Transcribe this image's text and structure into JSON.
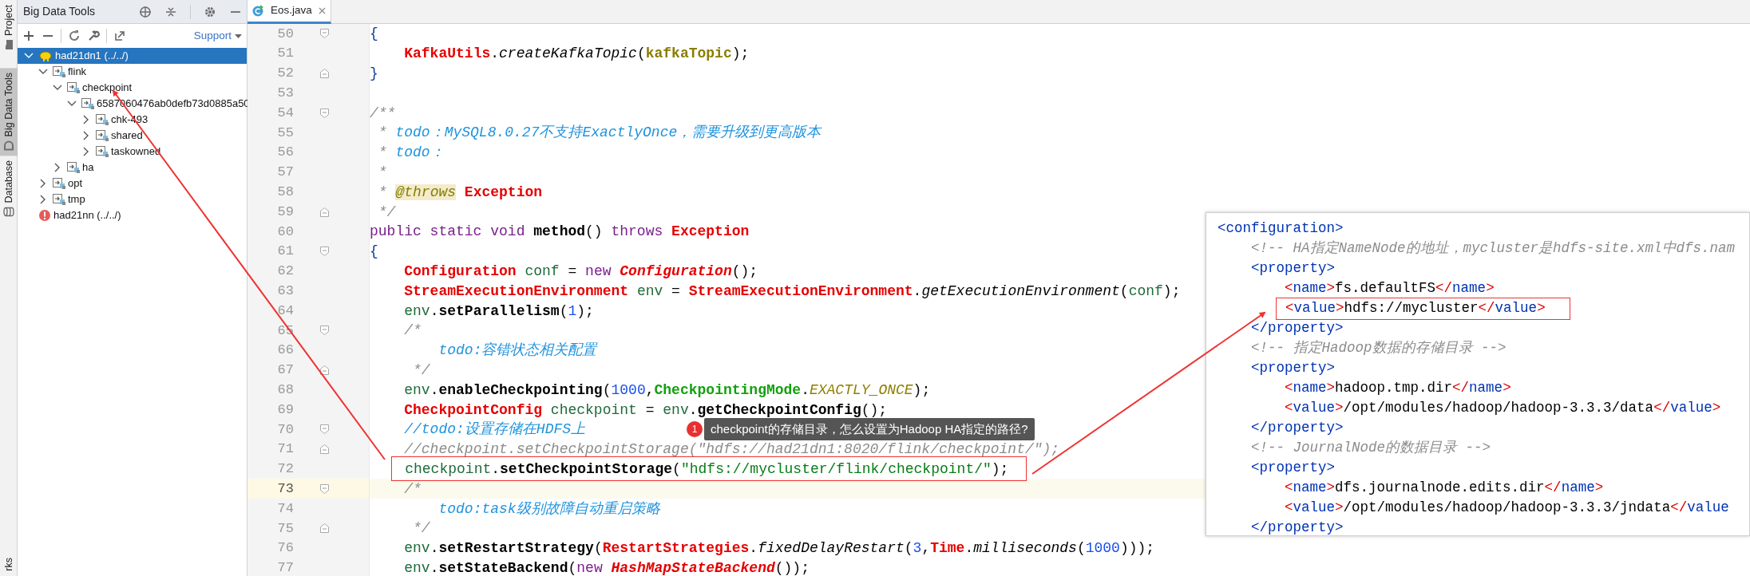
{
  "side_tabs": [
    {
      "label": "Project",
      "selected": false
    },
    {
      "label": "Big Data Tools",
      "selected": true
    },
    {
      "label": "Database",
      "selected": false
    },
    {
      "label": "rks",
      "selected": false
    }
  ],
  "panel": {
    "title": "Big Data Tools",
    "support": "Support"
  },
  "tree": [
    {
      "label": "had21dn1 (../../)",
      "kind": "cluster",
      "selected": true,
      "expanded": true,
      "children": [
        {
          "label": "flink",
          "kind": "folder",
          "selected": false,
          "expanded": true,
          "children": [
            {
              "label": "checkpoint",
              "kind": "folder",
              "selected": false,
              "expanded": true,
              "children": [
                {
                  "label": "6587060476ab0defb73d0885a50",
                  "kind": "folder",
                  "selected": false,
                  "expanded": true,
                  "children": [
                    {
                      "label": "chk-493",
                      "kind": "folder",
                      "selected": false,
                      "expanded": false
                    },
                    {
                      "label": "shared",
                      "kind": "folder",
                      "selected": false,
                      "expanded": false
                    },
                    {
                      "label": "taskowned",
                      "kind": "folder",
                      "selected": false,
                      "expanded": false
                    }
                  ]
                }
              ]
            },
            {
              "label": "ha",
              "kind": "folder",
              "selected": false,
              "expanded": false
            }
          ]
        },
        {
          "label": "opt",
          "kind": "folder",
          "selected": false,
          "expanded": false
        },
        {
          "label": "tmp",
          "kind": "folder",
          "selected": false,
          "expanded": false
        }
      ]
    },
    {
      "label": "had21nn (../../)",
      "kind": "failed",
      "selected": false
    }
  ],
  "editor": {
    "tabs": [
      {
        "label": "Eos.java",
        "selected": true
      }
    ],
    "lines": [
      {
        "number": "50",
        "current": false,
        "fold_start": true,
        "segments": [
          {
            "text": "{",
            "kind": "brace"
          }
        ]
      },
      {
        "number": "51",
        "current": false,
        "segments": [
          {
            "text": "    KafkaUtils",
            "kind": "cls"
          },
          {
            "text": ".",
            "kind": "plain"
          },
          {
            "text": "createKafkaTopic",
            "kind": "call"
          },
          {
            "text": "(",
            "kind": "plain"
          },
          {
            "text": "kafkaTopic",
            "kind": "param"
          },
          {
            "text": ");",
            "kind": "plain"
          }
        ]
      },
      {
        "number": "52",
        "current": false,
        "fold_end": true,
        "segments": [
          {
            "text": "}",
            "kind": "brace"
          }
        ]
      },
      {
        "number": "53",
        "current": false
      },
      {
        "number": "54",
        "current": false,
        "fold_start": true,
        "segments": [
          {
            "text": "/**",
            "kind": "cmt"
          }
        ]
      },
      {
        "number": "55",
        "current": false,
        "segments": [
          {
            "text": " * ",
            "kind": "cmt"
          },
          {
            "text": "todo：MySQL8.0.27不支持ExactlyOnce，需要升级到更高版本",
            "kind": "todo"
          }
        ]
      },
      {
        "number": "56",
        "current": false,
        "segments": [
          {
            "text": " * ",
            "kind": "cmt"
          },
          {
            "text": "todo：",
            "kind": "todo"
          }
        ]
      },
      {
        "number": "57",
        "current": false,
        "segments": [
          {
            "text": " *",
            "kind": "cmt"
          }
        ]
      },
      {
        "number": "58",
        "current": false,
        "segments": [
          {
            "text": " * ",
            "kind": "cmt"
          },
          {
            "text": "@throws",
            "kind": "ann"
          },
          {
            "text": " Exception",
            "kind": "cls"
          }
        ]
      },
      {
        "number": "59",
        "current": false,
        "fold_end": true,
        "segments": [
          {
            "text": " */",
            "kind": "cmt"
          }
        ]
      },
      {
        "number": "60",
        "current": false,
        "segments": [
          {
            "text": "public static void ",
            "kind": "kw"
          },
          {
            "text": "method",
            "kind": "method"
          },
          {
            "text": "()",
            "kind": "plain"
          },
          {
            "text": " throws ",
            "kind": "kw"
          },
          {
            "text": "Exception",
            "kind": "cls"
          }
        ]
      },
      {
        "number": "61",
        "current": false,
        "fold_start": true,
        "segments": [
          {
            "text": "{",
            "kind": "brace"
          }
        ]
      },
      {
        "number": "62",
        "current": false,
        "segments": [
          {
            "text": "    Configuration",
            "kind": "cls"
          },
          {
            "text": " conf",
            "kind": "local"
          },
          {
            "text": " = ",
            "kind": "plain"
          },
          {
            "text": "new ",
            "kind": "kw"
          },
          {
            "text": "Configuration",
            "kind": "clsi"
          },
          {
            "text": "();",
            "kind": "plain"
          }
        ]
      },
      {
        "number": "63",
        "current": false,
        "segments": [
          {
            "text": "    StreamExecutionEnvironment",
            "kind": "cls"
          },
          {
            "text": " env",
            "kind": "local"
          },
          {
            "text": " = ",
            "kind": "plain"
          },
          {
            "text": "StreamExecutionEnvironment",
            "kind": "cls"
          },
          {
            "text": ".",
            "kind": "plain"
          },
          {
            "text": "getExecutionEnvironment",
            "kind": "call"
          },
          {
            "text": "(",
            "kind": "plain"
          },
          {
            "text": "conf",
            "kind": "local"
          },
          {
            "text": ");",
            "kind": "plain"
          }
        ]
      },
      {
        "number": "64",
        "current": false,
        "segments": [
          {
            "text": "    env",
            "kind": "local"
          },
          {
            "text": ".",
            "kind": "plain"
          },
          {
            "text": "setParallelism",
            "kind": "method"
          },
          {
            "text": "(",
            "kind": "plain"
          },
          {
            "text": "1",
            "kind": "num"
          },
          {
            "text": ");",
            "kind": "plain"
          }
        ]
      },
      {
        "number": "65",
        "current": false,
        "fold_start": true,
        "segments": [
          {
            "text": "    /*",
            "kind": "cmt"
          }
        ]
      },
      {
        "number": "66",
        "current": false,
        "segments": [
          {
            "text": "        todo:容错状态相关配置",
            "kind": "todo"
          }
        ]
      },
      {
        "number": "67",
        "current": false,
        "fold_end": true,
        "segments": [
          {
            "text": "     */",
            "kind": "cmt"
          }
        ]
      },
      {
        "number": "68",
        "current": false,
        "segments": [
          {
            "text": "    env",
            "kind": "local"
          },
          {
            "text": ".",
            "kind": "plain"
          },
          {
            "text": "enableCheckpointing",
            "kind": "method"
          },
          {
            "text": "(",
            "kind": "plain"
          },
          {
            "text": "1000",
            "kind": "num"
          },
          {
            "text": ",",
            "kind": "plain"
          },
          {
            "text": "CheckpointingMode",
            "kind": "enum"
          },
          {
            "text": ".",
            "kind": "plain"
          },
          {
            "text": "EXACTLY_ONCE",
            "kind": "const"
          },
          {
            "text": ");",
            "kind": "plain"
          }
        ]
      },
      {
        "number": "69",
        "current": false,
        "segments": [
          {
            "text": "    CheckpointConfig",
            "kind": "cls"
          },
          {
            "text": " checkpoint",
            "kind": "local"
          },
          {
            "text": " = ",
            "kind": "plain"
          },
          {
            "text": "env",
            "kind": "local"
          },
          {
            "text": ".",
            "kind": "plain"
          },
          {
            "text": "getCheckpointConfig",
            "kind": "method"
          },
          {
            "text": "();",
            "kind": "plain"
          }
        ]
      },
      {
        "number": "70",
        "current": false,
        "fold_start": true,
        "segments": [
          {
            "text": "    //todo:设置存储在HDFS上",
            "kind": "todo"
          }
        ]
      },
      {
        "number": "71",
        "current": false,
        "fold_end": true,
        "segments": [
          {
            "text": "    //checkpoint.setCheckpointStorage(\"hdfs://had21dn1:8020/flink/checkpoint/\");",
            "kind": "cmt"
          }
        ]
      },
      {
        "number": "72",
        "current": false,
        "framed": true,
        "segments": [
          {
            "text": "    checkpoint",
            "kind": "local"
          },
          {
            "text": ".",
            "kind": "plain"
          },
          {
            "text": "setCheckpointStorage",
            "kind": "method"
          },
          {
            "text": "(",
            "kind": "plain"
          },
          {
            "text": "\"hdfs://mycluster/flink/checkpoint/\"",
            "kind": "str"
          },
          {
            "text": ");",
            "kind": "plain"
          }
        ]
      },
      {
        "number": "73",
        "current": true,
        "fold_start": true,
        "segments": [
          {
            "text": "    /*",
            "kind": "cmt"
          }
        ]
      },
      {
        "number": "74",
        "current": false,
        "segments": [
          {
            "text": "        todo:task级别故障自动重启策略",
            "kind": "todo"
          }
        ]
      },
      {
        "number": "75",
        "current": false,
        "fold_end": true,
        "segments": [
          {
            "text": "     */",
            "kind": "cmt"
          }
        ]
      },
      {
        "number": "76",
        "current": false,
        "segments": [
          {
            "text": "    env",
            "kind": "local"
          },
          {
            "text": ".",
            "kind": "plain"
          },
          {
            "text": "setRestartStrategy",
            "kind": "method"
          },
          {
            "text": "(",
            "kind": "plain"
          },
          {
            "text": "RestartStrategies",
            "kind": "cls"
          },
          {
            "text": ".",
            "kind": "plain"
          },
          {
            "text": "fixedDelayRestart",
            "kind": "call"
          },
          {
            "text": "(",
            "kind": "plain"
          },
          {
            "text": "3",
            "kind": "num"
          },
          {
            "text": ",",
            "kind": "plain"
          },
          {
            "text": "Time",
            "kind": "cls"
          },
          {
            "text": ".",
            "kind": "plain"
          },
          {
            "text": "milliseconds",
            "kind": "call"
          },
          {
            "text": "(",
            "kind": "plain"
          },
          {
            "text": "1000",
            "kind": "num"
          },
          {
            "text": ")));",
            "kind": "plain"
          }
        ]
      },
      {
        "number": "77",
        "current": false,
        "segments": [
          {
            "text": "    env",
            "kind": "local"
          },
          {
            "text": ".",
            "kind": "plain"
          },
          {
            "text": "setStateBackend",
            "kind": "method"
          },
          {
            "text": "(",
            "kind": "plain"
          },
          {
            "text": "new ",
            "kind": "kw"
          },
          {
            "text": "HashMapStateBackend",
            "kind": "clsi"
          },
          {
            "text": "());",
            "kind": "plain"
          }
        ]
      }
    ]
  },
  "note": {
    "badge": "1",
    "text": "checkpoint的存储目录，怎么设置为Hadoop HA指定的路径?"
  },
  "xml_snippet": {
    "lines": [
      {
        "segments": [
          {
            "text": "<configuration>",
            "kind": "tag"
          }
        ]
      },
      {
        "segments": [
          {
            "text": "    <!-- HA指定NameNode的地址，mycluster是hdfs-site.xml中dfs.nam",
            "kind": "cmt"
          }
        ]
      },
      {
        "segments": [
          {
            "text": "    <property>",
            "kind": "tag"
          }
        ]
      },
      {
        "segments": [
          {
            "text": "        <",
            "kind": "punct"
          },
          {
            "text": "name",
            "kind": "tag"
          },
          {
            "text": ">",
            "kind": "punct"
          },
          {
            "text": "fs.defaultFS",
            "kind": "text"
          },
          {
            "text": "</",
            "kind": "punct"
          },
          {
            "text": "name",
            "kind": "tag"
          },
          {
            "text": ">",
            "kind": "punct"
          }
        ]
      },
      {
        "framed": true,
        "segments": [
          {
            "text": "        <",
            "kind": "punct"
          },
          {
            "text": "value",
            "kind": "tag"
          },
          {
            "text": ">",
            "kind": "punct"
          },
          {
            "text": "hdfs://mycluster",
            "kind": "text"
          },
          {
            "text": "</",
            "kind": "punct"
          },
          {
            "text": "value",
            "kind": "tag"
          },
          {
            "text": ">",
            "kind": "punct"
          }
        ]
      },
      {
        "segments": [
          {
            "text": "    </property>",
            "kind": "tag"
          }
        ]
      },
      {
        "segments": [
          {
            "text": "    <!-- 指定Hadoop数据的存储目录 -->",
            "kind": "cmt"
          }
        ]
      },
      {
        "segments": [
          {
            "text": "    <property>",
            "kind": "tag"
          }
        ]
      },
      {
        "segments": [
          {
            "text": "        <",
            "kind": "punct"
          },
          {
            "text": "name",
            "kind": "tag"
          },
          {
            "text": ">",
            "kind": "punct"
          },
          {
            "text": "hadoop.tmp.dir",
            "kind": "text"
          },
          {
            "text": "</",
            "kind": "punct"
          },
          {
            "text": "name",
            "kind": "tag"
          },
          {
            "text": ">",
            "kind": "punct"
          }
        ]
      },
      {
        "segments": [
          {
            "text": "        <",
            "kind": "punct"
          },
          {
            "text": "value",
            "kind": "tag"
          },
          {
            "text": ">",
            "kind": "punct"
          },
          {
            "text": "/opt/modules/hadoop/hadoop-3.3.3/data",
            "kind": "text"
          },
          {
            "text": "</",
            "kind": "punct"
          },
          {
            "text": "value",
            "kind": "tag"
          },
          {
            "text": ">",
            "kind": "punct"
          }
        ]
      },
      {
        "segments": [
          {
            "text": "    </property>",
            "kind": "tag"
          }
        ]
      },
      {
        "segments": [
          {
            "text": "    <!-- JournalNode的数据目录 -->",
            "kind": "cmt"
          }
        ]
      },
      {
        "segments": [
          {
            "text": "    <property>",
            "kind": "tag"
          }
        ]
      },
      {
        "segments": [
          {
            "text": "        <",
            "kind": "punct"
          },
          {
            "text": "name",
            "kind": "tag"
          },
          {
            "text": ">",
            "kind": "punct"
          },
          {
            "text": "dfs.journalnode.edits.dir",
            "kind": "text"
          },
          {
            "text": "</",
            "kind": "punct"
          },
          {
            "text": "name",
            "kind": "tag"
          },
          {
            "text": ">",
            "kind": "punct"
          }
        ]
      },
      {
        "segments": [
          {
            "text": "        <",
            "kind": "punct"
          },
          {
            "text": "value",
            "kind": "tag"
          },
          {
            "text": ">",
            "kind": "punct"
          },
          {
            "text": "/opt/modules/hadoop/hadoop-3.3.3/jndata",
            "kind": "text"
          },
          {
            "text": "</",
            "kind": "punct"
          },
          {
            "text": "value",
            "kind": "tag"
          }
        ]
      },
      {
        "segments": [
          {
            "text": "    </property>",
            "kind": "tag"
          }
        ]
      }
    ]
  }
}
